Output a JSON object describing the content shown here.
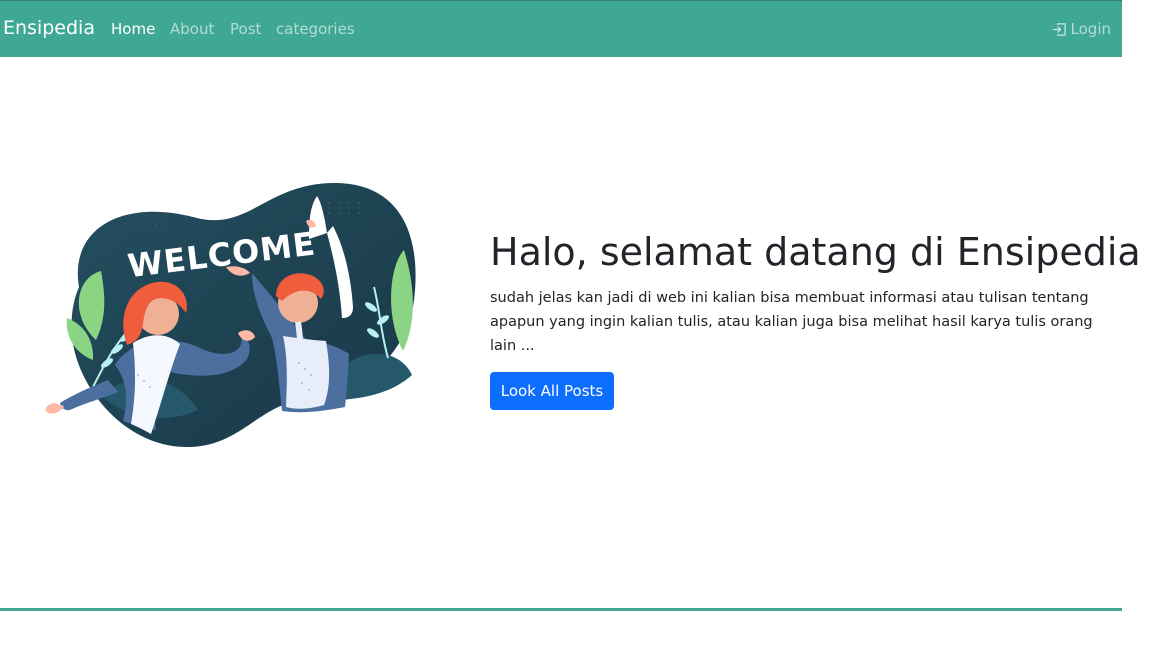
{
  "nav": {
    "brand": "Ensipedia",
    "items": [
      {
        "label": "Home",
        "active": true
      },
      {
        "label": "About",
        "active": false
      },
      {
        "label": "Post",
        "active": false
      },
      {
        "label": "categories",
        "active": false
      }
    ],
    "login": "Login",
    "login_icon": "login-icon"
  },
  "hero": {
    "illustration_text": "WELCOME",
    "title": "Halo, selamat datang di Ensipedia",
    "description": "sudah jelas kan jadi di web ini kalian bisa membuat informasi atau tulisan tentang apapun yang ingin kalian tulis, atau kalian juga bisa melihat hasil karya tulis orang lain ...",
    "button": "Look All Posts"
  },
  "colors": {
    "navbar": "#3fa895",
    "button": "#0d6efd",
    "text": "#212529",
    "illustration_bg": "#1f4b5a"
  }
}
